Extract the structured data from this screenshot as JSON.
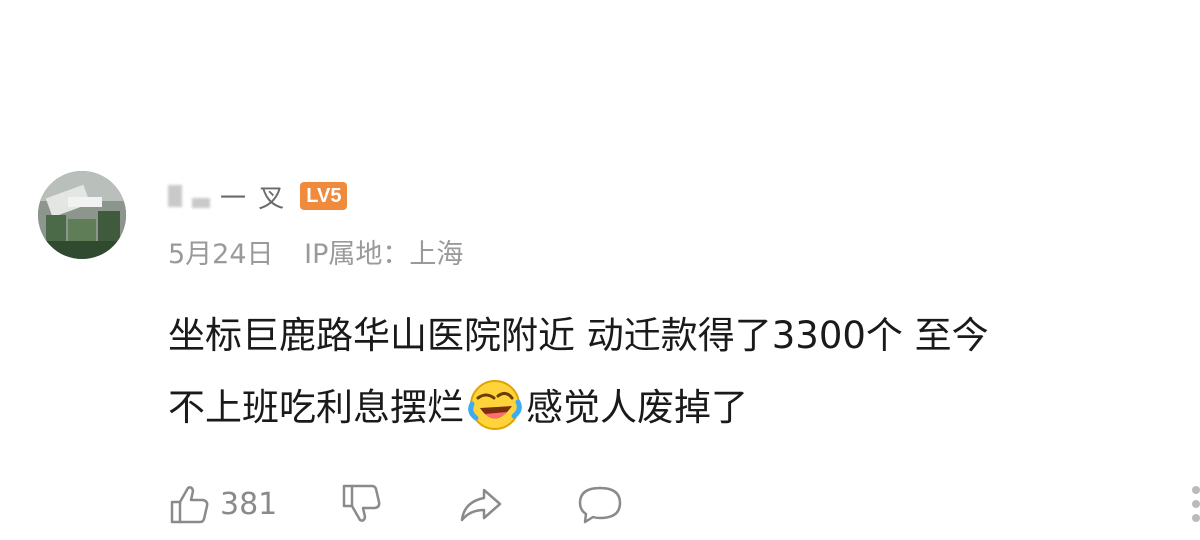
{
  "comment": {
    "user": {
      "name_fragment": "一 叉",
      "level_badge": "LV5"
    },
    "meta": {
      "date": "5月24日",
      "ip_location": "IP属地：上海"
    },
    "content": {
      "line1": "坐标巨鹿路华山医院附近 动迁款得了3300个 至今",
      "line2_before_emoji": "不上班吃利息摆烂",
      "emoji": "crying-laughing-emoji",
      "line2_after_emoji": "感觉人废掉了"
    },
    "actions": {
      "like_icon": "thumbs-up-icon",
      "like_count": "381",
      "dislike_icon": "thumbs-down-icon",
      "share_icon": "share-icon",
      "reply_icon": "comment-bubble-icon",
      "more_icon": "more-dots-icon"
    },
    "colors": {
      "level_badge": "#f08a3c",
      "meta_text": "#9a9a9a",
      "content_text": "#1a1a1a",
      "action_icon": "#888888"
    }
  }
}
